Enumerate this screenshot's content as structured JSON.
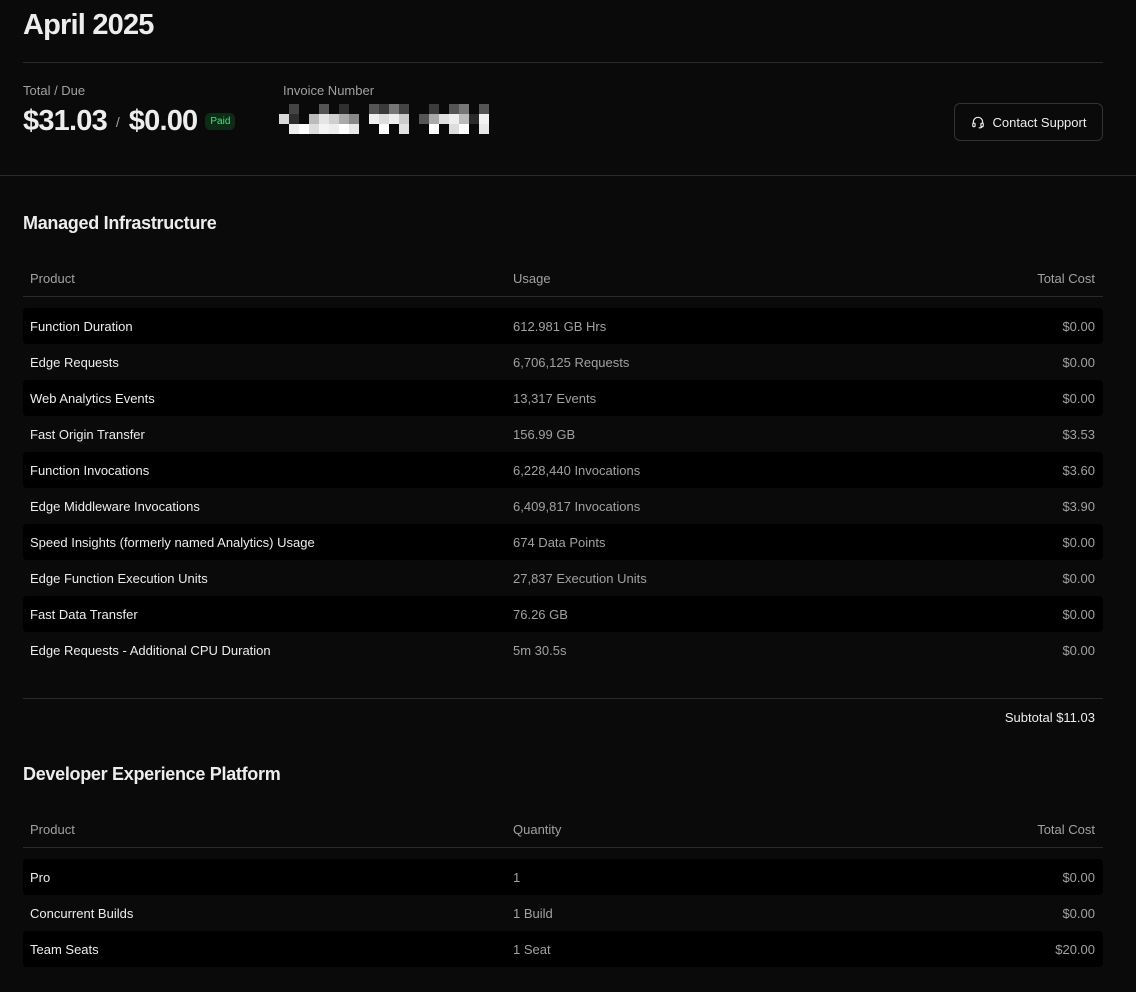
{
  "page": {
    "title": "April 2025"
  },
  "summary": {
    "total_due_label": "Total / Due",
    "total": "$31.03",
    "slash": "/",
    "due": "$0.00",
    "status_badge": "Paid",
    "invoice_label": "Invoice Number",
    "contact_support": "Contact Support"
  },
  "managed": {
    "title": "Managed Infrastructure",
    "headers": {
      "product": "Product",
      "usage": "Usage",
      "total_cost": "Total Cost"
    },
    "rows": [
      {
        "product": "Function Duration",
        "usage": "612.981 GB Hrs",
        "cost": "$0.00"
      },
      {
        "product": "Edge Requests",
        "usage": "6,706,125 Requests",
        "cost": "$0.00"
      },
      {
        "product": "Web Analytics Events",
        "usage": "13,317 Events",
        "cost": "$0.00"
      },
      {
        "product": "Fast Origin Transfer",
        "usage": "156.99 GB",
        "cost": "$3.53"
      },
      {
        "product": "Function Invocations",
        "usage": "6,228,440 Invocations",
        "cost": "$3.60"
      },
      {
        "product": "Edge Middleware Invocations",
        "usage": "6,409,817 Invocations",
        "cost": "$3.90"
      },
      {
        "product": "Speed Insights (formerly named Analytics) Usage",
        "usage": "674 Data Points",
        "cost": "$0.00"
      },
      {
        "product": "Edge Function Execution Units",
        "usage": "27,837 Execution Units",
        "cost": "$0.00"
      },
      {
        "product": "Fast Data Transfer",
        "usage": "76.26 GB",
        "cost": "$0.00"
      },
      {
        "product": "Edge Requests - Additional CPU Duration",
        "usage": "5m 30.5s",
        "cost": "$0.00"
      }
    ],
    "subtotal": "Subtotal $11.03"
  },
  "dev": {
    "title": "Developer Experience Platform",
    "headers": {
      "product": "Product",
      "quantity": "Quantity",
      "total_cost": "Total Cost"
    },
    "rows": [
      {
        "product": "Pro",
        "quantity": "1",
        "cost": "$0.00"
      },
      {
        "product": "Concurrent Builds",
        "quantity": "1 Build",
        "cost": "$0.00"
      },
      {
        "product": "Team Seats",
        "quantity": "1 Seat",
        "cost": "$20.00"
      }
    ]
  },
  "icons": {
    "support": "headset-icon"
  },
  "colors": {
    "background": "#0a0a0a",
    "paid_green": "#4ade80"
  }
}
